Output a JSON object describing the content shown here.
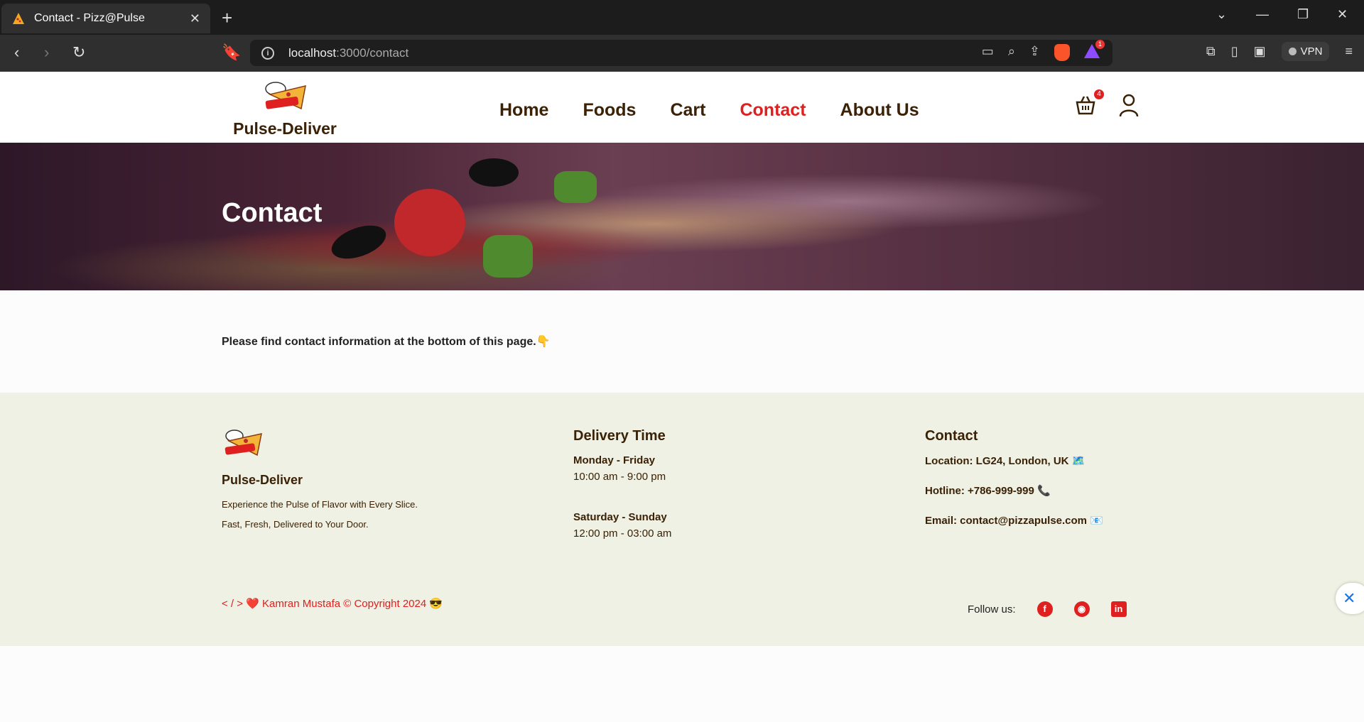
{
  "browser": {
    "tab_title": "Contact - Pizz@Pulse",
    "url_host": "localhost",
    "url_path": ":3000/contact",
    "vpn_label": "VPN",
    "rewards_badge": "1"
  },
  "site": {
    "brand": "Pulse-Deliver",
    "nav": [
      "Home",
      "Foods",
      "Cart",
      "Contact",
      "About Us"
    ],
    "active_nav": "Contact",
    "cart_count": "4",
    "accent_color": "#df2020",
    "text_color": "#3b2105"
  },
  "hero": {
    "title": "Contact"
  },
  "main": {
    "notice": "Please find contact information at the bottom of this page.👇"
  },
  "footer": {
    "brand": "Pulse-Deliver",
    "description": "Experience the Pulse of Flavor with Every Slice. Fast, Fresh, Delivered to Your Door.",
    "delivery": {
      "title": "Delivery Time",
      "weekday_label": "Monday - Friday",
      "weekday_hours": "10:00 am - 9:00 pm",
      "weekend_label": "Saturday - Sunday",
      "weekend_hours": "12:00 pm - 03:00 am"
    },
    "contact": {
      "title": "Contact",
      "location": "Location: LG24, London, UK 🗺️",
      "hotline": "Hotline: +786-999-999 📞",
      "email": "Email: contact@pizzapulse.com 📧"
    },
    "copyright": "< / > ❤️ Kamran Mustafa © Copyright 2024 😎",
    "follow_label": "Follow us:",
    "social": [
      "facebook-icon",
      "github-icon",
      "linkedin-icon"
    ]
  }
}
